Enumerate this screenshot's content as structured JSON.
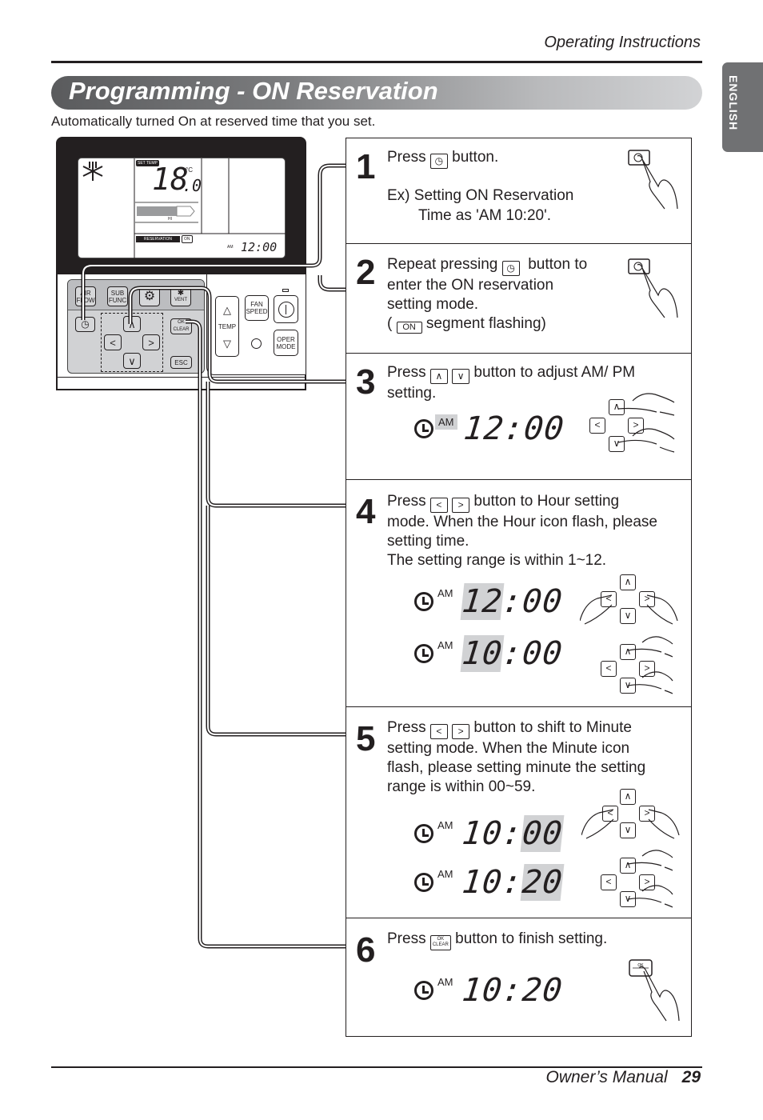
{
  "header": {
    "section": "Operating Instructions",
    "language_tab": "ENGLISH"
  },
  "banner": {
    "title": "Programming - ON Reservation"
  },
  "subtitle": "Automatically turned On at reserved time that you set.",
  "remote": {
    "lcd": {
      "set_temp_label": "SET TEMP",
      "temperature": "18",
      "temperature_decimal": ".0",
      "unit": "°C",
      "fan_level": "HI",
      "reservation_label": "RESERVATION",
      "on_label": "ON",
      "ampm": "AM",
      "time": "12:00",
      "mode_icon": "snowflake-cool-icon"
    },
    "buttons": {
      "air_flow": [
        "AIR",
        "FLOW"
      ],
      "sub_func": [
        "SUB",
        "FUNC"
      ],
      "settings_icon": "gear-icon",
      "vent": "VENT",
      "reservation_icon": "clock-icon",
      "up": "∧",
      "down": "∨",
      "left": "<",
      "right": ">",
      "ok": "OK",
      "clear": "CLEAR",
      "esc": "ESC",
      "temp_up": "△",
      "temp_label": "TEMP",
      "temp_down": "▽",
      "fan": [
        "FAN",
        "SPEED"
      ],
      "power": "⏽",
      "oper": [
        "OPER",
        "MODE"
      ]
    }
  },
  "steps": [
    {
      "number": "1",
      "text_before": "Press",
      "text_after": "button.",
      "example_line1": "Ex) Setting ON Reservation",
      "example_line2": "Time as 'AM 10:20'."
    },
    {
      "number": "2",
      "text_before": "Repeat pressing",
      "text_after": "button to",
      "line2": "enter the ON reservation",
      "line3": "setting mode.",
      "line4_open": "(",
      "line4_badge": "ON",
      "line4_close": "segment flashing)"
    },
    {
      "number": "3",
      "text_before": "Press",
      "text_after": "button to adjust AM/ PM",
      "line2": "setting.",
      "display": {
        "ampm": "AM",
        "time": "12:00",
        "highlight": "ampm"
      }
    },
    {
      "number": "4",
      "text_before": "Press",
      "text_after": "button to Hour setting",
      "line2": "mode. When the Hour icon flash, please",
      "line3": "setting time.",
      "line4": "The setting range is within 1~12.",
      "displays": [
        {
          "ampm": "AM",
          "hour": "12",
          "minute": "00",
          "highlight": "hour"
        },
        {
          "ampm": "AM",
          "hour": "10",
          "minute": "00",
          "highlight": "hour"
        }
      ]
    },
    {
      "number": "5",
      "text_before": "Press",
      "text_after": "button to shift to Minute",
      "line2": "setting mode. When the Minute icon",
      "line3": "flash, please setting minute the setting",
      "line4": "range is within 00~59.",
      "displays": [
        {
          "ampm": "AM",
          "hour": "10",
          "minute": "00",
          "highlight": "minute"
        },
        {
          "ampm": "AM",
          "hour": "10",
          "minute": "20",
          "highlight": "minute"
        }
      ]
    },
    {
      "number": "6",
      "text_before": "Press",
      "text_after": "button to finish setting.",
      "display": {
        "ampm": "AM",
        "time": "10:20"
      }
    }
  ],
  "inline_buttons": {
    "clock": "◷",
    "up": "∧",
    "down": "∨",
    "left": "<",
    "right": ">",
    "ok": "OK",
    "clear": "CLEAR",
    "colon": ":"
  },
  "footer": {
    "manual": "Owner’s Manual",
    "page": "29"
  }
}
